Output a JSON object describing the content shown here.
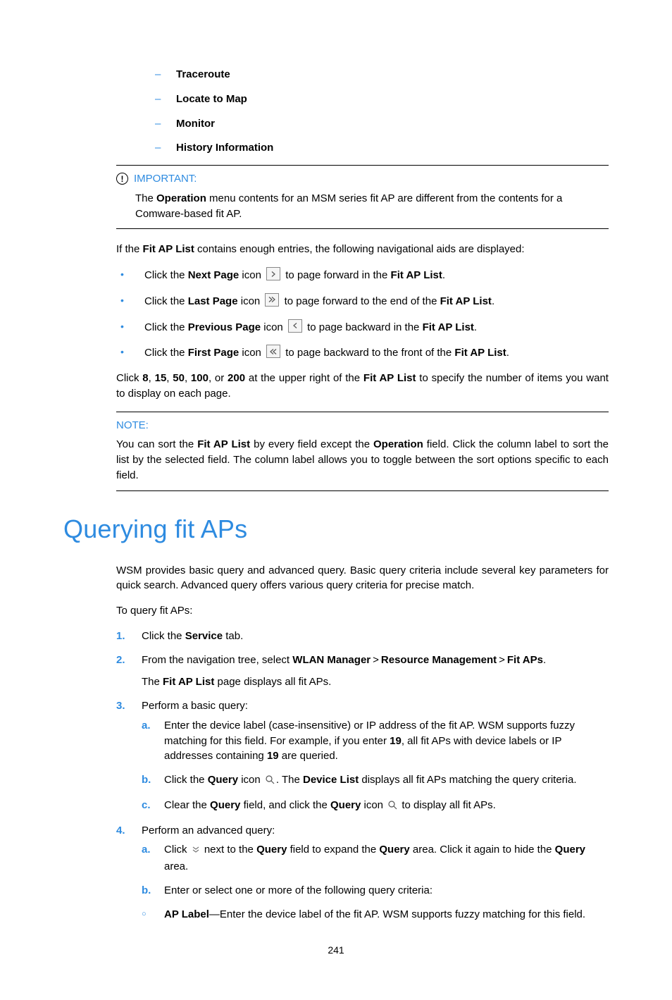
{
  "dashItems": [
    "Traceroute",
    "Locate to Map",
    "Monitor",
    "History Information"
  ],
  "important": {
    "label": "IMPORTANT:",
    "t1": "The ",
    "b1": "Operation",
    "t2": " menu contents for an MSM series fit AP are different from the contents for a Comware-based fit AP."
  },
  "navIntro": {
    "t1": "If the ",
    "b1": "Fit AP List",
    "t2": " contains enough entries, the following navigational aids are displayed:"
  },
  "navBullets": [
    {
      "t1": "Click the ",
      "b1": "Next Page",
      "t2": " icon ",
      "t3": " to page forward in the ",
      "b2": "Fit AP List",
      "t4": "."
    },
    {
      "t1": "Click the ",
      "b1": "Last Page",
      "t2": " icon ",
      "t3": " to page forward to the end of the ",
      "b2": "Fit AP List",
      "t4": "."
    },
    {
      "t1": "Click the ",
      "b1": "Previous Page",
      "t2": " icon ",
      "t3": " to page backward in the ",
      "b2": "Fit AP List",
      "t4": "."
    },
    {
      "t1": "Click the ",
      "b1": "First Page",
      "t2": " icon ",
      "t3": " to page backward to the front of the ",
      "b2": "Fit AP List",
      "t4": "."
    }
  ],
  "pageSize": {
    "t1": "Click ",
    "b1": "8",
    "t2": ", ",
    "b2": "15",
    "t3": ", ",
    "b3": "50",
    "t4": ", ",
    "b4": "100",
    "t5": ", or ",
    "b5": "200",
    "t6": " at the upper right of the ",
    "b6": "Fit AP List",
    "t7": " to specify the number of items you want to display on each page."
  },
  "note": {
    "label": "NOTE:",
    "t1": "You can sort the ",
    "b1": "Fit AP List",
    "t2": " by every field except the ",
    "b2": "Operation",
    "t3": " field. Click the column label to sort the list by the selected field. The column label allows you to toggle between the sort options specific to each field."
  },
  "h1": "Querying fit APs",
  "queryIntro": "WSM provides basic query and advanced query. Basic query criteria include several key parameters for quick search. Advanced query offers various query criteria for precise match.",
  "queryLead": "To query fit APs:",
  "step1": {
    "n": "1.",
    "t1": "Click the ",
    "b1": "Service",
    "t2": " tab."
  },
  "step2": {
    "n": "2.",
    "t1": "From the navigation tree, select ",
    "b1": "WLAN Manager",
    "b2": "Resource Management",
    "b3": "Fit APs",
    "tEnd": ".",
    "line2t1": "The ",
    "line2b1": "Fit AP List",
    "line2t2": " page displays all fit APs."
  },
  "step3": {
    "n": "3.",
    "t1": "Perform a basic query:",
    "a": {
      "l": "a.",
      "t1": "Enter the device label (case-insensitive) or IP address of the fit AP. WSM supports fuzzy matching for this field. For example, if you enter ",
      "b1": "19",
      "t2": ", all fit APs with device labels or IP addresses containing ",
      "b2": "19",
      "t3": " are queried."
    },
    "b": {
      "l": "b.",
      "t1": "Click the ",
      "b1": "Query",
      "t2": " icon ",
      "t3": ". The ",
      "b2": "Device List",
      "t4": " displays all fit APs matching the query criteria."
    },
    "c": {
      "l": "c.",
      "t1": "Clear the ",
      "b1": "Query",
      "t2": " field, and click the ",
      "b2": "Query",
      "t3": " icon ",
      "t4": " to display all fit APs."
    }
  },
  "step4": {
    "n": "4.",
    "t1": "Perform an advanced query:",
    "a": {
      "l": "a.",
      "t1": "Click ",
      "t2": " next to the ",
      "b1": "Query",
      "t3": " field to expand the ",
      "b2": "Query",
      "t4": " area. Click it again to hide the ",
      "b3": "Query",
      "t5": " area."
    },
    "b": {
      "l": "b.",
      "t1": "Enter or select one or more of the following query criteria:"
    },
    "c": {
      "b1": "AP Label",
      "t1": "—Enter the device label of the fit AP. WSM supports fuzzy matching for this field."
    }
  },
  "pagenum": "241",
  "gt": ">"
}
